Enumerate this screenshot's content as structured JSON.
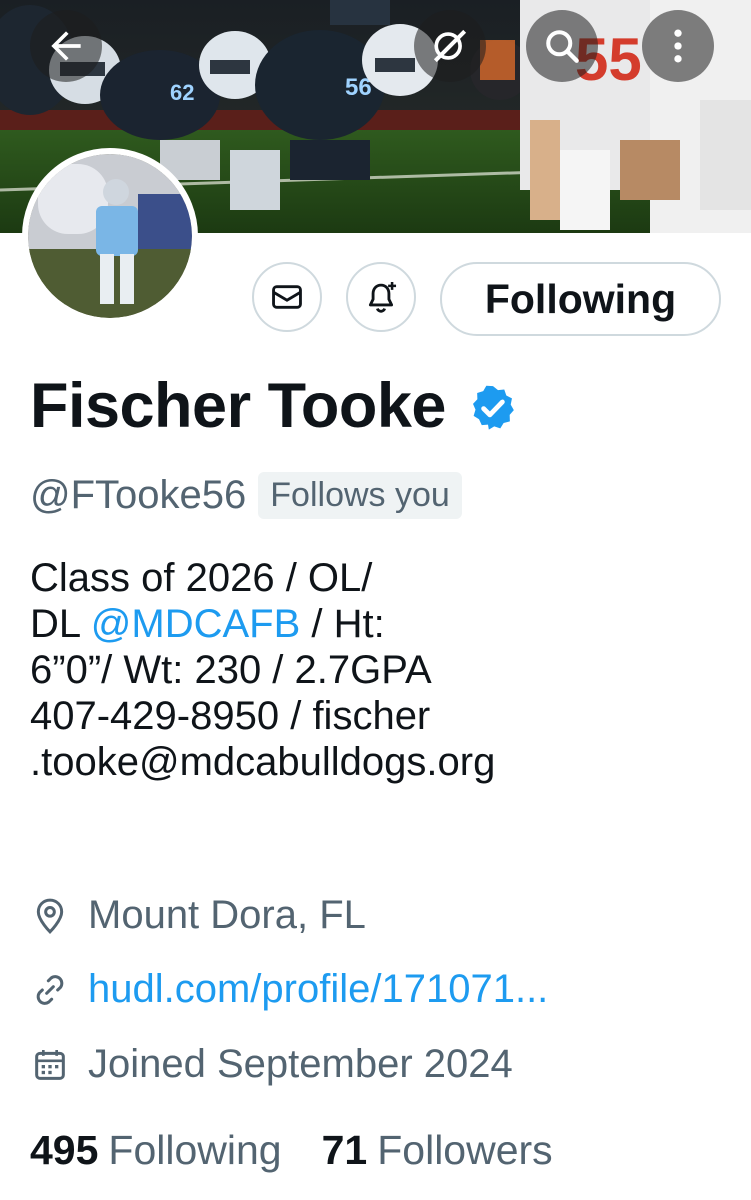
{
  "header": {
    "back_icon": "arrow-left-icon",
    "grok_icon": "grok-icon",
    "search_icon": "search-icon",
    "more_icon": "more-vertical-icon"
  },
  "profile": {
    "name": "Fischer Tooke",
    "handle": "@FTooke56",
    "follows_you": "Follows you",
    "verified": true,
    "actions": {
      "message_icon": "mail-icon",
      "notify_icon": "bell-plus-icon",
      "following_label": "Following"
    },
    "bio": {
      "line1": "Class of 2026 / OL/",
      "line2_prefix": "DL ",
      "line2_mention": "@MDCAFB",
      "line2_suffix": " / Ht:",
      "line3": "6”0”/ Wt: 230 / 2.7GPA",
      "line4": "407-429-8950 / fischer",
      "line5": ".tooke@mdcabulldogs.org"
    },
    "location": "Mount Dora, FL",
    "website": "hudl.com/profile/171071...",
    "joined": "Joined September 2024",
    "stats": {
      "following_count": "495",
      "following_label": "Following",
      "followers_count": "71",
      "followers_label": "Followers"
    }
  },
  "colors": {
    "accent": "#1d9bf0",
    "secondary_text": "#536471",
    "border": "#cfd9de"
  }
}
